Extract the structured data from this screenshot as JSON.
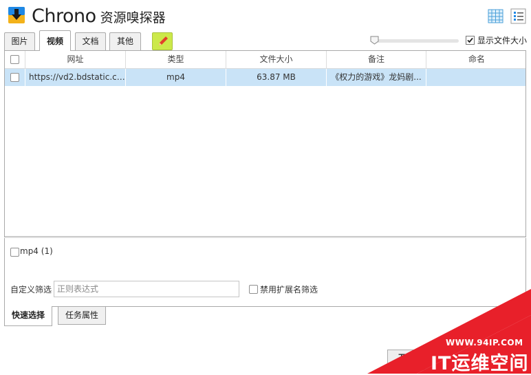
{
  "header": {
    "title_main": "Chrono",
    "title_sub": "资源嗅探器",
    "grid_view_icon": "grid-view-icon",
    "list_view_icon": "list-view-icon",
    "accent_color": "#1e88e5"
  },
  "type_tabs": [
    {
      "label": "图片",
      "active": false
    },
    {
      "label": "视频",
      "active": true
    },
    {
      "label": "文档",
      "active": false
    },
    {
      "label": "其他",
      "active": false
    }
  ],
  "toolbar": {
    "edit_icon": "pencil-icon",
    "edit_button_color": "#cce94a",
    "show_size_label": "显示文件大小",
    "show_size_checked": true,
    "slider_value": 0
  },
  "table": {
    "columns": [
      "网址",
      "类型",
      "文件大小",
      "备注",
      "命名"
    ],
    "rows": [
      {
        "checked": false,
        "url": "https://vd2.bdstatic.co...",
        "type": "mp4",
        "size": "63.87 MB",
        "note": "《权力的游戏》龙妈剧...",
        "name": "",
        "selected": true
      }
    ],
    "selected_row_color": "#c9e3f7"
  },
  "filters": {
    "type_filters": [
      {
        "label": "mp4 (1)",
        "checked": false
      }
    ],
    "custom_filter_label": "自定义筛选",
    "regex_placeholder": "正则表达式",
    "regex_value": "",
    "disable_ext_label": "禁用扩展名筛选",
    "disable_ext_checked": false
  },
  "bottom_tabs": [
    {
      "label": "快速选择",
      "active": true
    },
    {
      "label": "任务属性",
      "active": false
    }
  ],
  "actions": {
    "start_label": "开始"
  },
  "watermark": {
    "url": "WWW.94IP.COM",
    "brand": "IT运维空间",
    "color": "#e8202a"
  }
}
